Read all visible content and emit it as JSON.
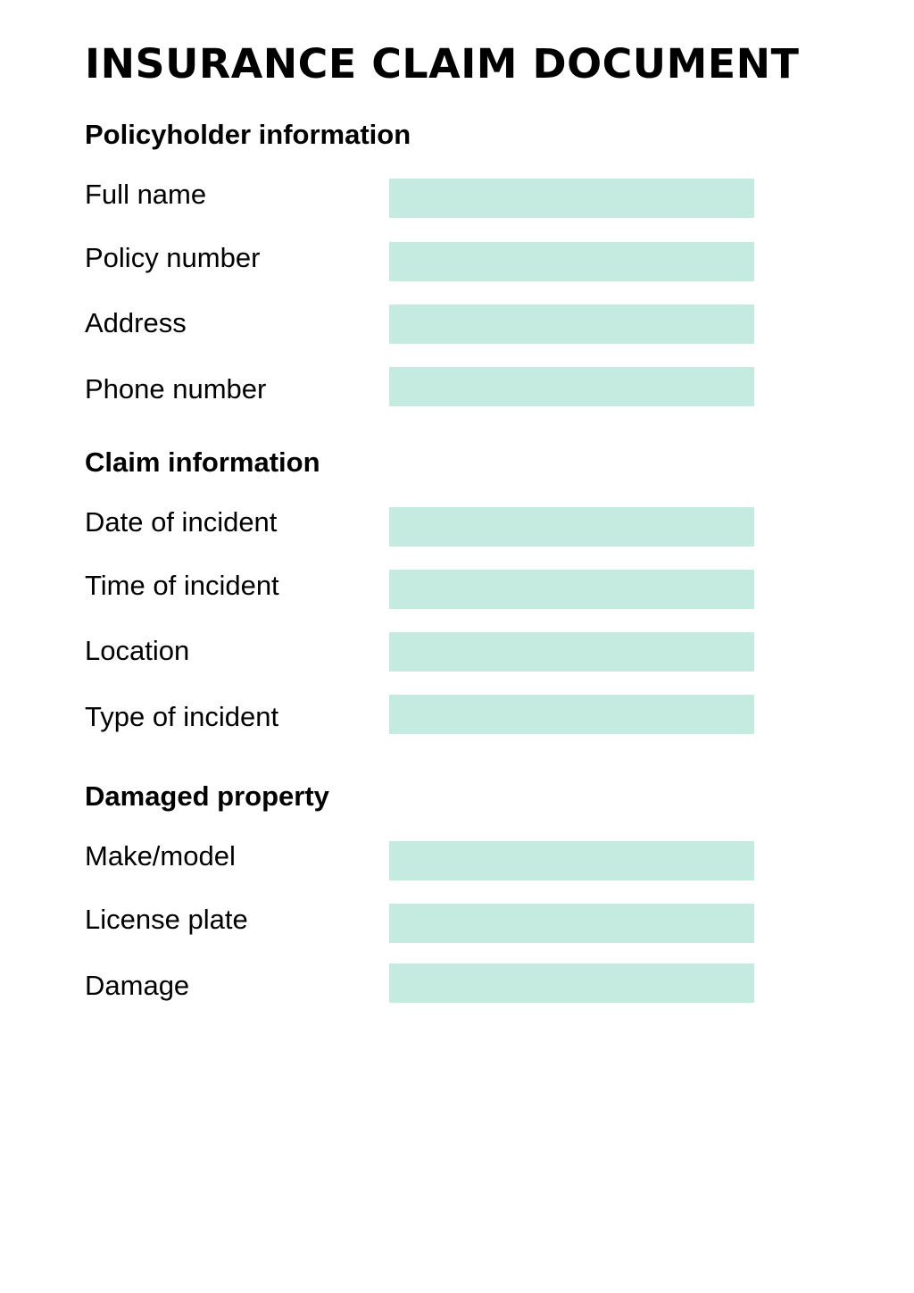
{
  "document": {
    "title": "INSURANCE CLAIM DOCUMENT",
    "field_color": "#c5eadf"
  },
  "sections": [
    {
      "heading": "Policyholder information",
      "fields": [
        {
          "label": "Full name",
          "value": ""
        },
        {
          "label": "Policy number",
          "value": ""
        },
        {
          "label": "Address",
          "value": ""
        },
        {
          "label": "Phone number",
          "value": ""
        }
      ]
    },
    {
      "heading": "Claim information",
      "fields": [
        {
          "label": "Date of incident",
          "value": ""
        },
        {
          "label": "Time of incident",
          "value": ""
        },
        {
          "label": "Location",
          "value": ""
        },
        {
          "label": "Type of incident",
          "value": ""
        }
      ]
    },
    {
      "heading": "Damaged property",
      "fields": [
        {
          "label": "Make/model",
          "value": ""
        },
        {
          "label": "License plate",
          "value": ""
        },
        {
          "label": "Damage",
          "value": ""
        }
      ]
    }
  ]
}
